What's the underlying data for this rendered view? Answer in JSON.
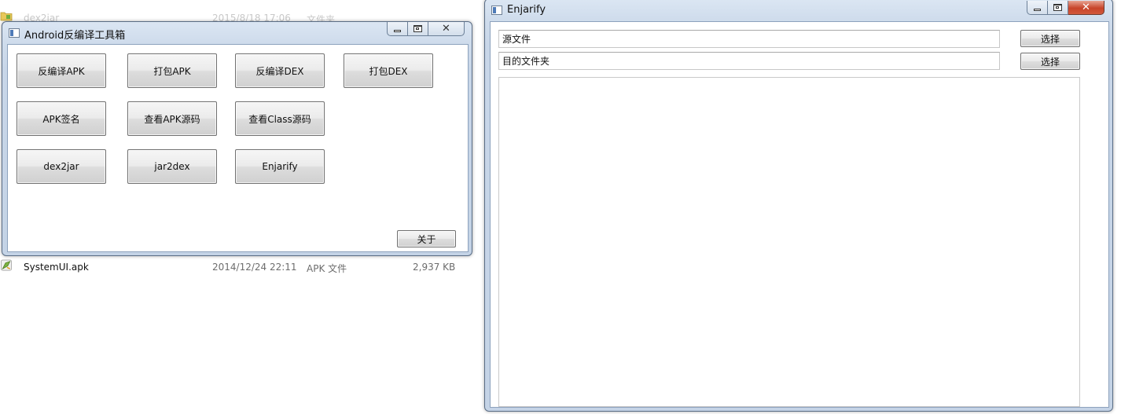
{
  "explorer": {
    "rows": [
      {
        "name": "dex2jar",
        "date": "2015/8/18 17:06",
        "type": "文件夹",
        "size": ""
      },
      {
        "name": "SystemUI.apk",
        "date": "2014/12/24 22:11",
        "type": "APK 文件",
        "size": "2,937 KB"
      }
    ]
  },
  "toolbox": {
    "title": "Android反编译工具箱",
    "buttons": {
      "decompile_apk": "反编译APK",
      "pack_apk": "打包APK",
      "decompile_dex": "反编译DEX",
      "pack_dex": "打包DEX",
      "apk_sign": "APK签名",
      "view_apk_source": "查看APK源码",
      "view_class_source": "查看Class源码",
      "dex2jar": "dex2jar",
      "jar2dex": "jar2dex",
      "enjarify": "Enjarify"
    },
    "about_label": "关于"
  },
  "enjarify": {
    "title": "Enjarify",
    "source_field": {
      "value": "源文件"
    },
    "dest_field": {
      "value": "目的文件夹"
    },
    "choose_label": "选择",
    "output_text": ""
  },
  "colors": {
    "window_frame": "#c8d6e8",
    "close_button_active": "#c7442a"
  }
}
